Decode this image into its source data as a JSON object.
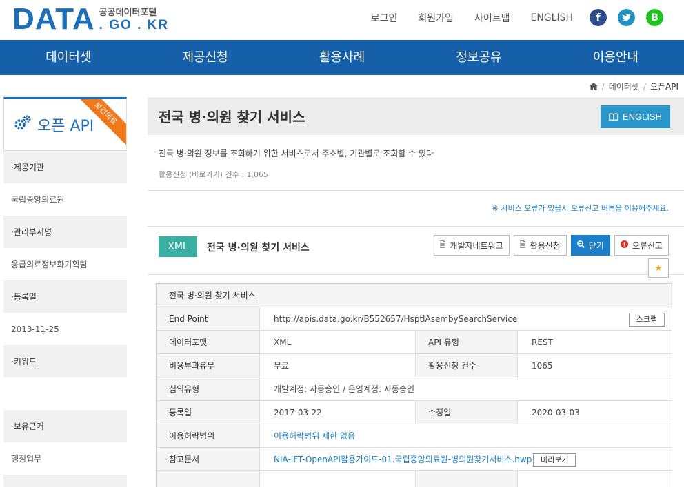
{
  "header": {
    "logo_main": "DATA",
    "logo_korean": "공공데이터포털",
    "logo_domain": ". GO . KR",
    "util_links": [
      "로그인",
      "회원가입",
      "사이트맵",
      "ENGLISH"
    ],
    "social": [
      {
        "icon": "facebook-icon",
        "glyph": "f",
        "color": "#2f4d8c"
      },
      {
        "icon": "twitter-icon",
        "glyph": "t",
        "color": "#1f93c6"
      },
      {
        "icon": "blog-icon",
        "glyph": "B",
        "color": "#21c321"
      }
    ]
  },
  "gnb": [
    "데이터셋",
    "제공신청",
    "활용사례",
    "정보공유",
    "이용안내"
  ],
  "breadcrumb": [
    "데이터셋",
    "오픈API"
  ],
  "sidebar": {
    "title": "오픈 API",
    "ribbon": "보건의료",
    "rows": [
      {
        "label": "·제공기관",
        "value": "국립중앙의료원"
      },
      {
        "label": "·관리부서명",
        "value": "응급의료정보화기획팀"
      },
      {
        "label": "·등록일",
        "value": "2013-11-25"
      },
      {
        "label": "·키워드",
        "value": ""
      },
      {
        "label": "·보유근거",
        "value": "행정업무"
      }
    ]
  },
  "main": {
    "title": "전국 병·의원 찾기 서비스",
    "english_button": "ENGLISH",
    "description": "전국 병·의원 정보를 조회하기 위한 서비스로서 주소별, 기관별로 조회할 수 있다",
    "count_text": "활용신청 (바로가기) 건수 : 1,065",
    "notice": "※ 서비스 오류가 있을시 오류신고 버튼을 이용해주세요.",
    "api": {
      "format_badge": "XML",
      "name": "전국 병·의원 찾기 서비스",
      "buttons": {
        "dev_network": "개발자네트워크",
        "apply": "활용신청",
        "close": "닫기",
        "report_error": "오류신고"
      }
    },
    "table": {
      "header": "전국 병·의원 찾기 서비스",
      "end_point_label": "End Point",
      "end_point": "http://apis.data.go.kr/B552657/HsptlAsembySearchService",
      "scrap_button": "스크랩",
      "data_format_label": "데이터포맷",
      "data_format": "XML",
      "api_type_label": "API 유형",
      "api_type": "REST",
      "fee_label": "비용부과유무",
      "fee": "무료",
      "apply_count_label": "활용신청 건수",
      "apply_count": "1065",
      "review_label": "심의유형",
      "review": "개발계정: 자동승인 / 운영계정: 자동승인",
      "reg_date_label": "등록일",
      "reg_date": "2017-03-22",
      "mod_date_label": "수정일",
      "mod_date": "2020-03-03",
      "license_label": "이용허락범위",
      "license": "이용허락범위 제한 없음",
      "ref_doc_label": "참고문서",
      "ref_doc": "NIA-IFT-OpenAPI활용가이드-01.국립중앙의료원-병의원찾기서비스.hwp",
      "preview_button": "미리보기"
    }
  }
}
